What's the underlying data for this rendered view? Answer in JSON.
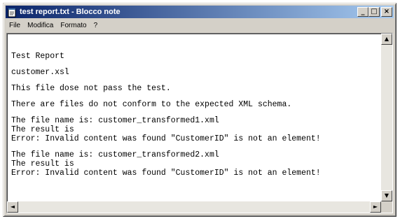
{
  "window": {
    "title": "test report.txt - Blocco note",
    "minimize": "_",
    "maximize": "□",
    "close": "×"
  },
  "menu": [
    "File",
    "Modifica",
    "Formato",
    "?"
  ],
  "content": {
    "lines": [
      "Test Report",
      "customer.xsl",
      "This file dose not pass the test.",
      "There are files do not conform to the expected XML schema.",
      "The file name is: customer_transformed1.xml",
      "The result is",
      "Error: Invalid content was found \"CustomerID\" is not an element!",
      "The file name is: customer_transformed2.xml",
      "The result is",
      "Error: Invalid content was found \"CustomerID\" is not an element!"
    ]
  },
  "scrollbars": {
    "up": "▲",
    "down": "▼",
    "left": "◄",
    "right": "►"
  }
}
